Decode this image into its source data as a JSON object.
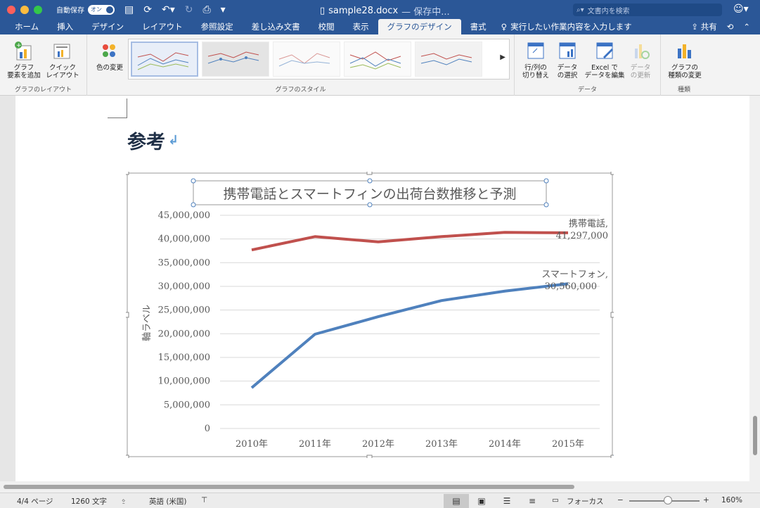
{
  "window": {
    "autosave_label": "自動保存",
    "autosave_state": "オン",
    "doc_name": "sample28.docx",
    "doc_status": "— 保存中...",
    "search_placeholder": "文書内を検索"
  },
  "tabs": [
    "ホーム",
    "挿入",
    "デザイン",
    "レイアウト",
    "参照設定",
    "差し込み文書",
    "校閲",
    "表示",
    "グラフのデザイン",
    "書式"
  ],
  "active_tab": "グラフのデザイン",
  "tell_me": "実行したい作業内容を入力します",
  "share": "共有",
  "ribbon": {
    "layout_group": {
      "label": "グラフのレイアウト",
      "add_element": "グラフ\n要素を追加",
      "quick_layout": "クイック\nレイアウト"
    },
    "color_change": "色の変更",
    "styles_label": "グラフのスタイル",
    "data_group": {
      "label": "データ",
      "switch_rowcol": "行/列の\n切り替え",
      "select_data": "データ\nの選択",
      "edit_excel": "Excel で\nデータを編集",
      "refresh_data": "データ\nの更新"
    },
    "type_group": {
      "label": "種類",
      "change_type": "グラフの\n種類の変更"
    }
  },
  "document": {
    "heading": "参考"
  },
  "chart_data": {
    "type": "line",
    "title": "携帯電話とスマートフィンの出荷台数推移と予測",
    "ylabel": "軸ラベル",
    "xlabel": "",
    "categories": [
      "2010年",
      "2011年",
      "2012年",
      "2013年",
      "2014年",
      "2015年"
    ],
    "yticks": [
      "0",
      "5,000,000",
      "10,000,000",
      "15,000,000",
      "20,000,000",
      "25,000,000",
      "30,000,000",
      "35,000,000",
      "40,000,000",
      "45,000,000"
    ],
    "ylim": [
      0,
      45000000
    ],
    "grid": true,
    "series": [
      {
        "name": "携帯電話",
        "color": "#c0504d",
        "values": [
          37700000,
          40500000,
          39400000,
          40500000,
          41400000,
          41297000
        ],
        "end_label_name": "携帯電話,",
        "end_label_value": "41,297,000"
      },
      {
        "name": "スマートフォン",
        "color": "#4f81bd",
        "values": [
          8600000,
          19900000,
          23600000,
          27000000,
          29000000,
          30560000
        ],
        "end_label_name": "スマートフォン,",
        "end_label_value": "30,560,000"
      }
    ]
  },
  "status": {
    "page": "4/4 ページ",
    "words": "1260 文字",
    "language": "英語 (米国)",
    "focus": "フォーカス",
    "zoom": "160%"
  }
}
